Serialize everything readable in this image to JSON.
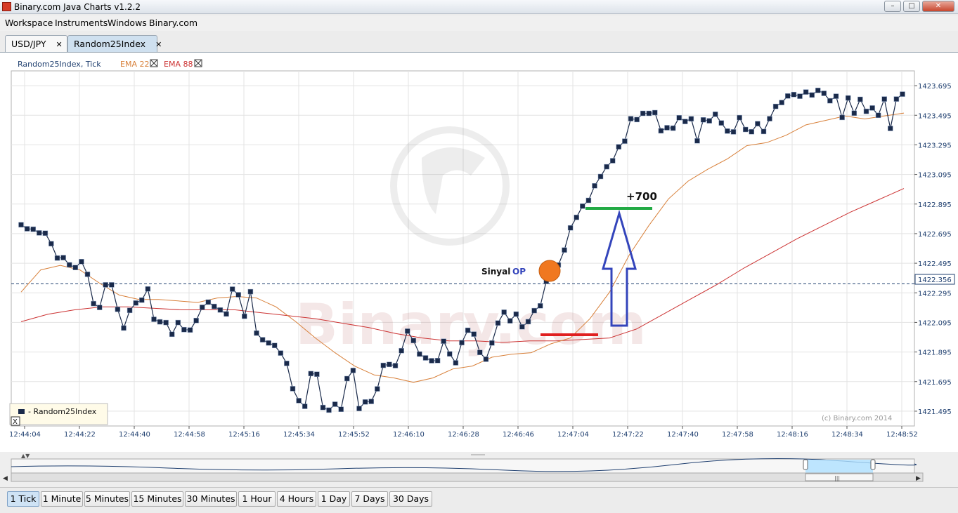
{
  "window": {
    "title": "Binary.com Java Charts v1.2.2",
    "controls": [
      "–",
      "□",
      "✕"
    ]
  },
  "menu": [
    "Workspace",
    "Instruments",
    "Windows",
    "Binary.com"
  ],
  "tabs": [
    {
      "label": "USD/JPY",
      "active": false
    },
    {
      "label": "Random25Index",
      "active": true
    }
  ],
  "chart": {
    "header_label": "Random25Index, Tick",
    "indicators": [
      {
        "label": "EMA 22",
        "color": "#d8803a"
      },
      {
        "label": "EMA 88",
        "color": "#cc3333"
      }
    ],
    "legend_label": "- Random25Index",
    "legend_close": "X",
    "copyright": "(c) Binary.com 2014",
    "watermark": "Binary.com",
    "current_price_label": "1422.356",
    "annotations": {
      "signal_text": "Sinyal",
      "signal_op": "OP",
      "profit": "+700"
    },
    "colors": {
      "tick": "#1a2a4a",
      "ema22": "#d8803a",
      "ema88": "#cc3333",
      "current_line": "#1f3f6f",
      "green_mark": "#22aa44",
      "red_mark": "#e02020",
      "arrow": "#3344bb",
      "circle": "#f07820"
    }
  },
  "chart_data": {
    "type": "line",
    "title": "Random25Index, Tick",
    "xlabel": "",
    "ylabel": "",
    "ylim": [
      1421.395,
      1423.795
    ],
    "y_ticks": [
      "1423.695",
      "1423.495",
      "1423.295",
      "1423.095",
      "1422.895",
      "1422.695",
      "1422.495",
      "1422.295",
      "1422.095",
      "1421.895",
      "1421.695",
      "1421.495"
    ],
    "y_tick_values": [
      1423.695,
      1423.495,
      1423.295,
      1423.095,
      1422.895,
      1422.695,
      1422.495,
      1422.295,
      1422.095,
      1421.895,
      1421.695,
      1421.495
    ],
    "x_ticks": [
      "12:44:04",
      "12:44:22",
      "12:44:40",
      "12:44:58",
      "12:45:16",
      "12:45:34",
      "12:45:52",
      "12:46:10",
      "12:46:28",
      "12:46:46",
      "12:47:04",
      "12:47:22",
      "12:47:40",
      "12:47:58",
      "12:48:16",
      "12:48:34",
      "12:48:52"
    ],
    "current_price": 1422.356,
    "series": [
      {
        "name": "Random25Index",
        "values": [
          1422.755,
          1422.728,
          1422.725,
          1422.7,
          1422.698,
          1422.627,
          1422.53,
          1422.533,
          1422.484,
          1422.466,
          1422.506,
          1422.42,
          1422.222,
          1422.196,
          1422.349,
          1422.349,
          1422.184,
          1422.057,
          1422.176,
          1422.226,
          1422.246,
          1422.321,
          1422.116,
          1422.099,
          1422.094,
          1422.015,
          1422.094,
          1422.046,
          1422.044,
          1422.108,
          1422.197,
          1422.232,
          1422.203,
          1422.179,
          1422.152,
          1422.32,
          1422.282,
          1422.137,
          1422.303,
          1422.023,
          1421.978,
          1421.956,
          1421.939,
          1421.888,
          1421.818,
          1421.647,
          1421.566,
          1421.528,
          1421.749,
          1421.745,
          1421.52,
          1421.502,
          1421.542,
          1421.508,
          1421.715,
          1421.77,
          1421.513,
          1421.557,
          1421.561,
          1421.646,
          1421.805,
          1421.811,
          1421.803,
          1421.904,
          1422.036,
          1421.972,
          1421.881,
          1421.855,
          1421.836,
          1421.837,
          1421.968,
          1421.882,
          1421.822,
          1421.958,
          1422.042,
          1422.016,
          1421.892,
          1421.846,
          1421.956,
          1422.091,
          1422.164,
          1422.106,
          1422.151,
          1422.065,
          1422.1,
          1422.175,
          1422.207,
          1422.372,
          1422.469,
          1422.483,
          1422.584,
          1422.734,
          1422.805,
          1422.881,
          1422.92,
          1423.018,
          1423.081,
          1423.147,
          1423.188,
          1423.282,
          1423.32,
          1423.472,
          1423.466,
          1423.508,
          1423.508,
          1423.513,
          1423.39,
          1423.411,
          1423.408,
          1423.478,
          1423.453,
          1423.471,
          1423.322,
          1423.464,
          1423.458,
          1423.502,
          1423.443,
          1423.388,
          1423.383,
          1423.479,
          1423.399,
          1423.384,
          1423.438,
          1423.385,
          1423.472,
          1423.555,
          1423.581,
          1423.625,
          1423.635,
          1423.624,
          1423.652,
          1423.632,
          1423.663,
          1423.643,
          1423.593,
          1423.624,
          1423.48,
          1423.612,
          1423.509,
          1423.603,
          1423.522,
          1423.544,
          1423.495,
          1423.605,
          1423.406,
          1423.605,
          1423.638
        ]
      },
      {
        "name": "EMA 22",
        "values": [
          1422.3,
          1422.45,
          1422.48,
          1422.45,
          1422.36,
          1422.28,
          1422.25,
          1422.25,
          1422.24,
          1422.23,
          1422.26,
          1422.27,
          1422.26,
          1422.2,
          1422.1,
          1421.99,
          1421.89,
          1421.8,
          1421.74,
          1421.72,
          1421.69,
          1421.72,
          1421.78,
          1421.8,
          1421.86,
          1421.88,
          1421.89,
          1421.95,
          1421.99,
          1422.12,
          1422.3,
          1422.55,
          1422.75,
          1422.93,
          1423.05,
          1423.13,
          1423.2,
          1423.29,
          1423.31,
          1423.36,
          1423.43,
          1423.46,
          1423.49,
          1423.47,
          1423.49,
          1423.51
        ]
      },
      {
        "name": "EMA 88",
        "values": [
          1422.1,
          1422.15,
          1422.18,
          1422.2,
          1422.2,
          1422.19,
          1422.18,
          1422.18,
          1422.18,
          1422.16,
          1422.14,
          1422.12,
          1422.09,
          1422.06,
          1422.02,
          1421.99,
          1421.97,
          1421.97,
          1421.96,
          1421.97,
          1421.97,
          1421.98,
          1421.99,
          1422.05,
          1422.15,
          1422.25,
          1422.35,
          1422.46,
          1422.56,
          1422.66,
          1422.75,
          1422.84,
          1422.92,
          1423.0
        ]
      }
    ],
    "legend": [
      "- Random25Index"
    ],
    "grid": true
  },
  "timeline": {
    "scroll_left": "◀",
    "scroll_right": "▶",
    "grip": "|||"
  },
  "periods": [
    {
      "label": "1 Tick",
      "active": true
    },
    {
      "label": "1 Minute",
      "active": false
    },
    {
      "label": "5 Minutes",
      "active": false
    },
    {
      "label": "15 Minutes",
      "active": false
    },
    {
      "label": "30 Minutes",
      "active": false
    },
    {
      "label": "1 Hour",
      "active": false
    },
    {
      "label": "4 Hours",
      "active": false
    },
    {
      "label": "1 Day",
      "active": false
    },
    {
      "label": "7 Days",
      "active": false
    },
    {
      "label": "30 Days",
      "active": false
    }
  ]
}
